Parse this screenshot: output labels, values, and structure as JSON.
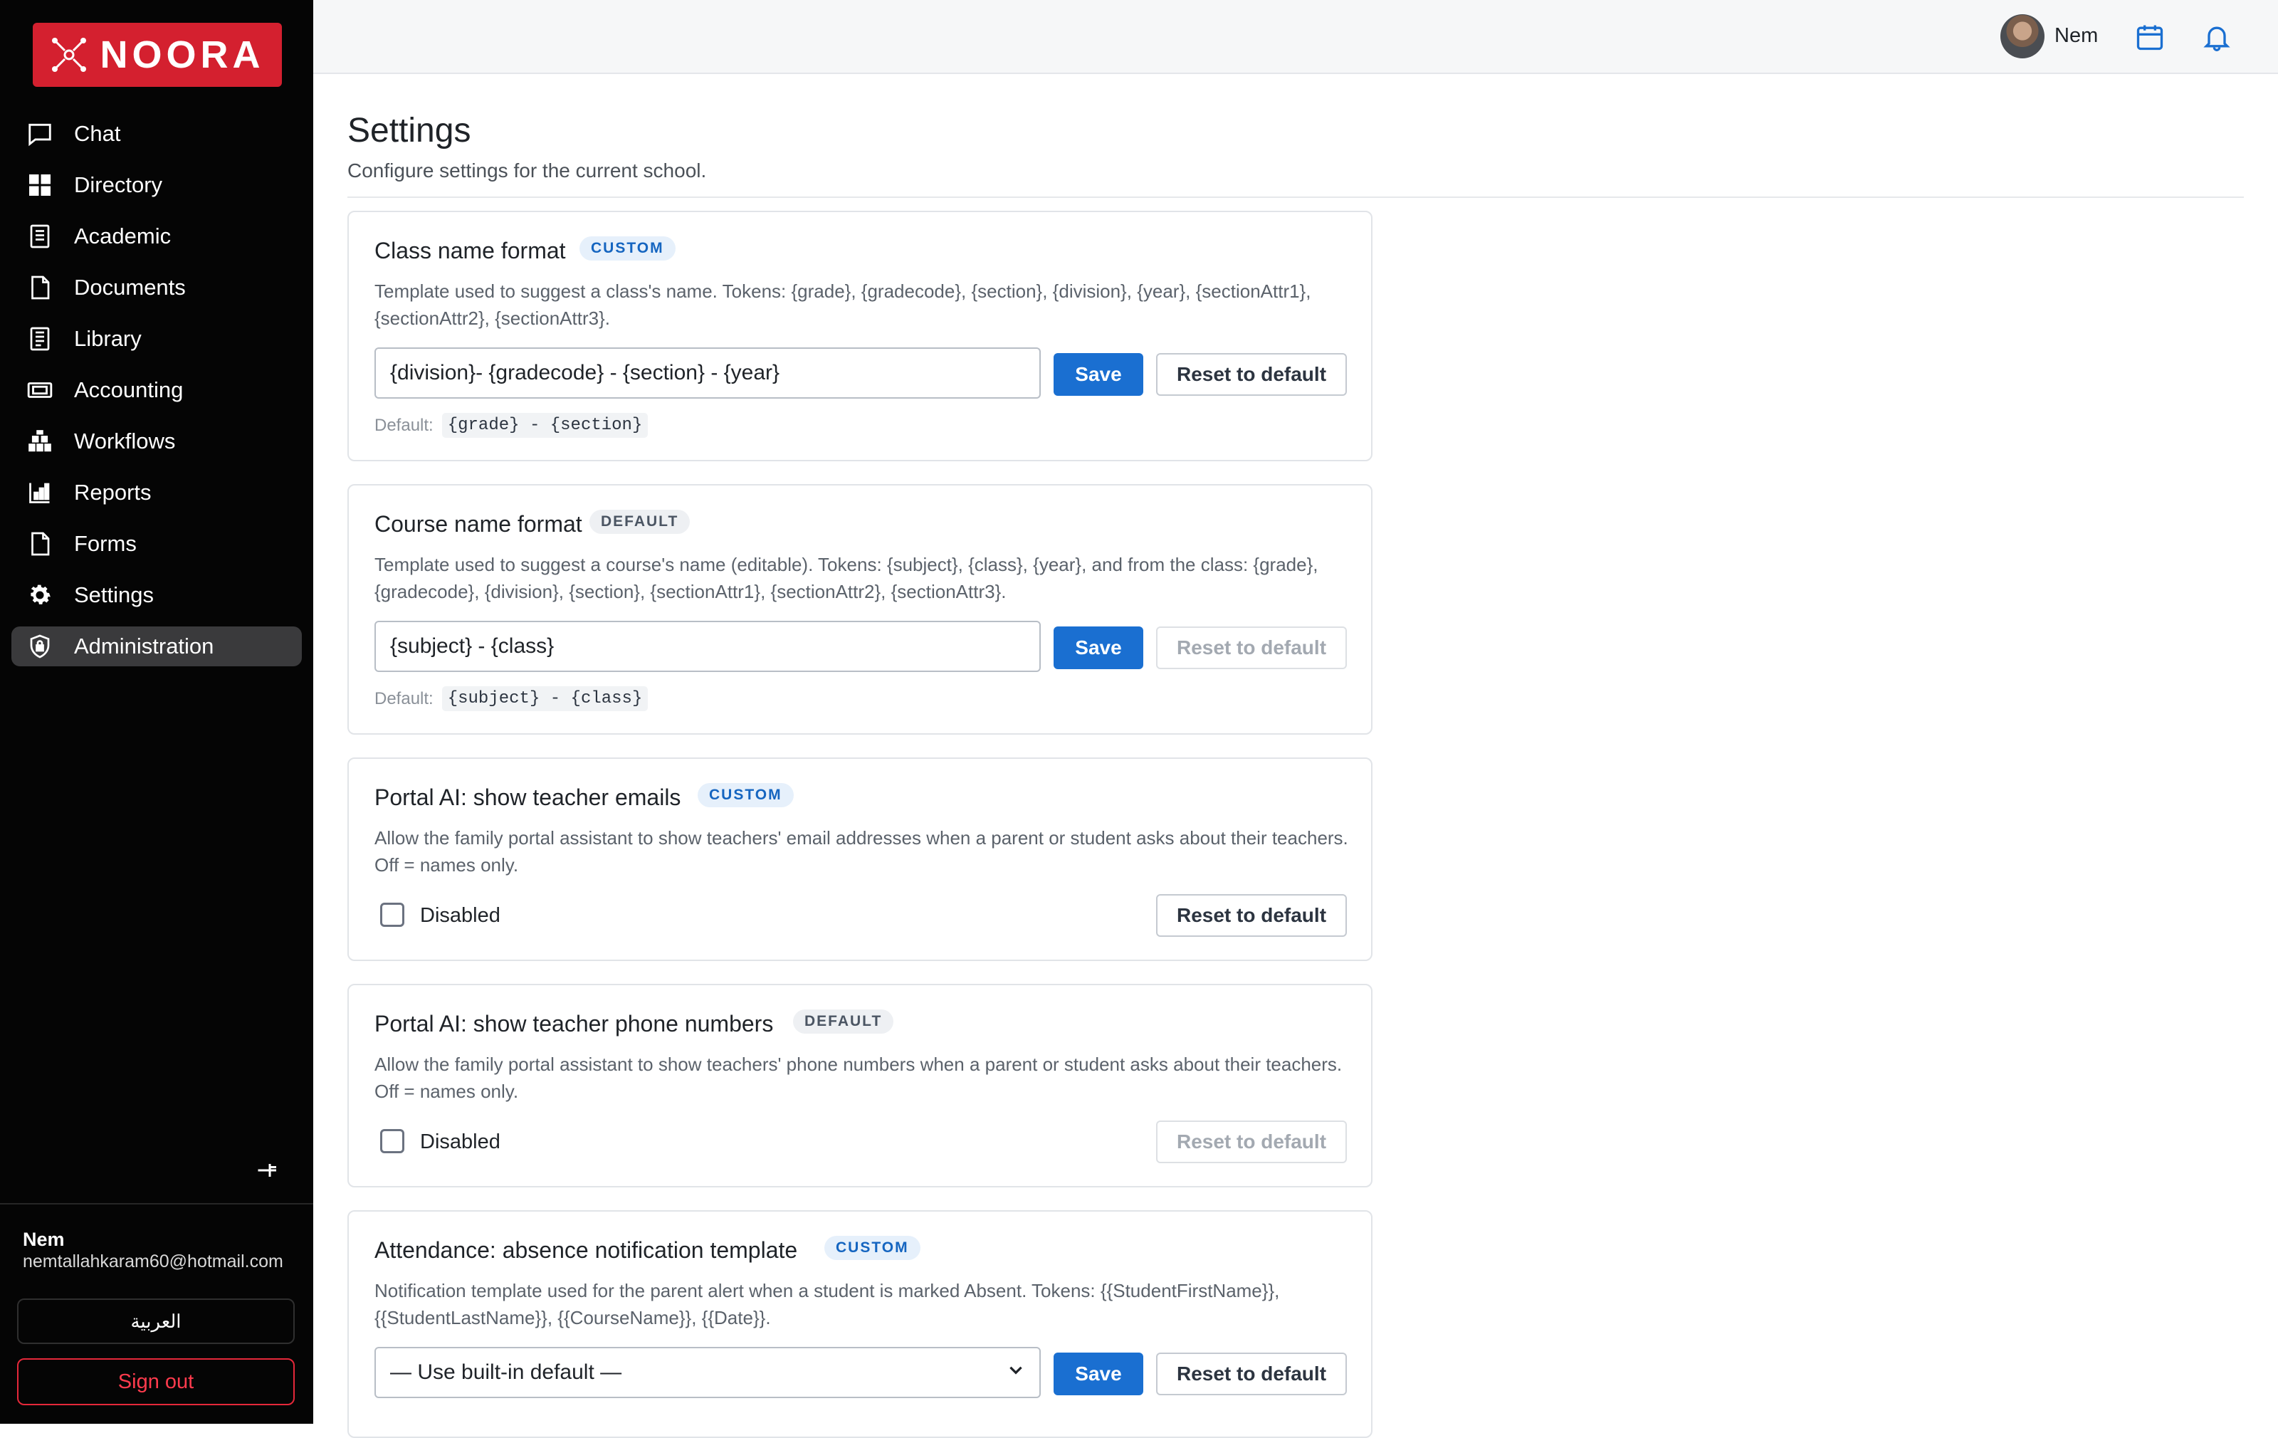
{
  "brand": {
    "name": "NOORA",
    "color": "#d4202f"
  },
  "sidebar": {
    "items": [
      {
        "label": "Chat",
        "icon": "chat-icon"
      },
      {
        "label": "Directory",
        "icon": "grid-icon"
      },
      {
        "label": "Academic",
        "icon": "book-icon"
      },
      {
        "label": "Documents",
        "icon": "document-icon"
      },
      {
        "label": "Library",
        "icon": "library-icon"
      },
      {
        "label": "Accounting",
        "icon": "money-icon"
      },
      {
        "label": "Workflows",
        "icon": "workflow-icon"
      },
      {
        "label": "Reports",
        "icon": "chart-icon"
      },
      {
        "label": "Forms",
        "icon": "form-icon"
      },
      {
        "label": "Settings",
        "icon": "gear-icon"
      },
      {
        "label": "Administration",
        "icon": "shield-lock-icon",
        "active": true
      }
    ],
    "user": {
      "name": "Nem",
      "email": "nemtallahkaram60@hotmail.com"
    },
    "language_label": "العربية",
    "signout_label": "Sign out"
  },
  "topbar": {
    "user_name": "Nem"
  },
  "page": {
    "title": "Settings",
    "subtitle": "Configure settings for the current school."
  },
  "cards": [
    {
      "title": "Class name format",
      "badge": "CUSTOM",
      "description": "Template used to suggest a class's name. Tokens: {grade}, {gradecode}, {section}, {division}, {year}, {sectionAttr1}, {sectionAttr2}, {sectionAttr3}.",
      "value": "{division}- {gradecode} - {section} - {year}",
      "save_label": "Save",
      "reset_label": "Reset to default",
      "default_label": "Default:",
      "default_value": "{grade} - {section}"
    },
    {
      "title": "Course name format",
      "badge": "DEFAULT",
      "description": "Template used to suggest a course's name (editable). Tokens: {subject}, {class}, {year}, and from the class: {grade}, {gradecode}, {division}, {section}, {sectionAttr1}, {sectionAttr2}, {sectionAttr3}.",
      "value": "{subject} - {class}",
      "save_label": "Save",
      "reset_label": "Reset to default",
      "default_label": "Default:",
      "default_value": "{subject} - {class}"
    },
    {
      "title": "Portal AI: show teacher emails",
      "badge": "CUSTOM",
      "description": "Allow the family portal assistant to show teachers' email addresses when a parent or student asks about their teachers. Off = names only.",
      "checkbox_label": "Disabled",
      "checked": false,
      "reset_label": "Reset to default"
    },
    {
      "title": "Portal AI: show teacher phone numbers",
      "badge": "DEFAULT",
      "description": "Allow the family portal assistant to show teachers' phone numbers when a parent or student asks about their teachers. Off = names only.",
      "checkbox_label": "Disabled",
      "checked": false,
      "reset_label": "Reset to default"
    },
    {
      "title": "Attendance: absence notification template",
      "badge": "CUSTOM",
      "description": "Notification template used for the parent alert when a student is marked Absent. Tokens: {{StudentFirstName}}, {{StudentLastName}}, {{CourseName}}, {{Date}}.",
      "selected_option": "— Use built-in default —",
      "save_label": "Save",
      "reset_label": "Reset to default"
    }
  ]
}
